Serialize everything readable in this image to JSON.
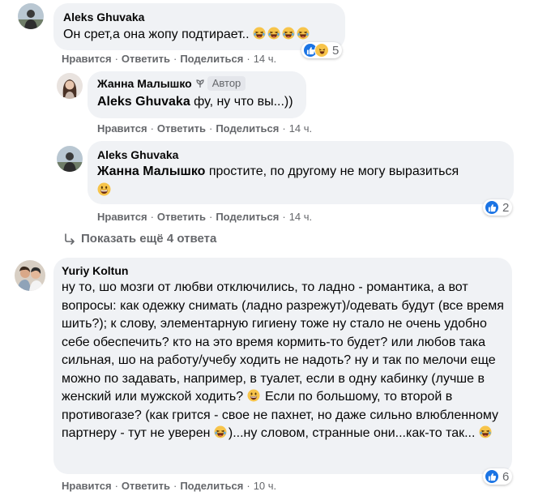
{
  "comments": [
    {
      "author": "Aleks Ghuvaka",
      "text": "Он срет,а она жопу подтирает.. ",
      "actions": {
        "like": "Нравится",
        "reply": "Ответить",
        "share": "Поделиться",
        "time": "14 ч."
      },
      "reaction_count": "5"
    },
    {
      "author": "Жанна Малышко",
      "badge": "Автор",
      "mention": "Aleks Ghuvaka",
      "text": " фу, ну что вы...))",
      "actions": {
        "like": "Нравится",
        "reply": "Ответить",
        "share": "Поделиться",
        "time": "14 ч."
      }
    },
    {
      "author": "Aleks Ghuvaka",
      "mention": "Жанна Малышко",
      "text": " простите, по другому не могу выразиться",
      "actions": {
        "like": "Нравится",
        "reply": "Ответить",
        "share": "Поделиться",
        "time": "14 ч."
      },
      "reaction_count": "2"
    },
    {
      "author": "Yuriy Koltun",
      "text_1": "ну то, шо мозги от любви отключились, то ладно - романтика, а вот вопросы: как одежку снимать (ладно разрежут)/одевать будут (все время шить?); к слову, элементарную гигиену тоже ну стало не очень удобно себе обеспечить? кто на это время кормить-то будет? или любов така сильная, шо на работу/учебу ходить не надоть? ну и так по мелочи еще можно по задавать, например, в туалет, если в одну кабинку (лучше в женский или мужской ходить? ",
      "text_2": " Если по большому, то второй в противогазе? (как грится - свое не пахнет, но даже сильно влюбленному партнеру - тут не уверен ",
      "text_3": ")...ну словом, странные они...как-то так... ",
      "actions": {
        "like": "Нравится",
        "reply": "Ответить",
        "share": "Поделиться",
        "time": "10 ч."
      },
      "reaction_count": "6"
    }
  ],
  "show_more": "Показать ещё 4 ответа",
  "icons": [
    "laughing-emoji-icon",
    "grinning-emoji-icon",
    "like-reaction-icon",
    "haha-reaction-icon",
    "reply-arrow-icon",
    "leaf-icon"
  ],
  "colors": {
    "bubble": "#f0f2f5",
    "meta": "#65676b",
    "like_blue": "#1b74e4"
  }
}
